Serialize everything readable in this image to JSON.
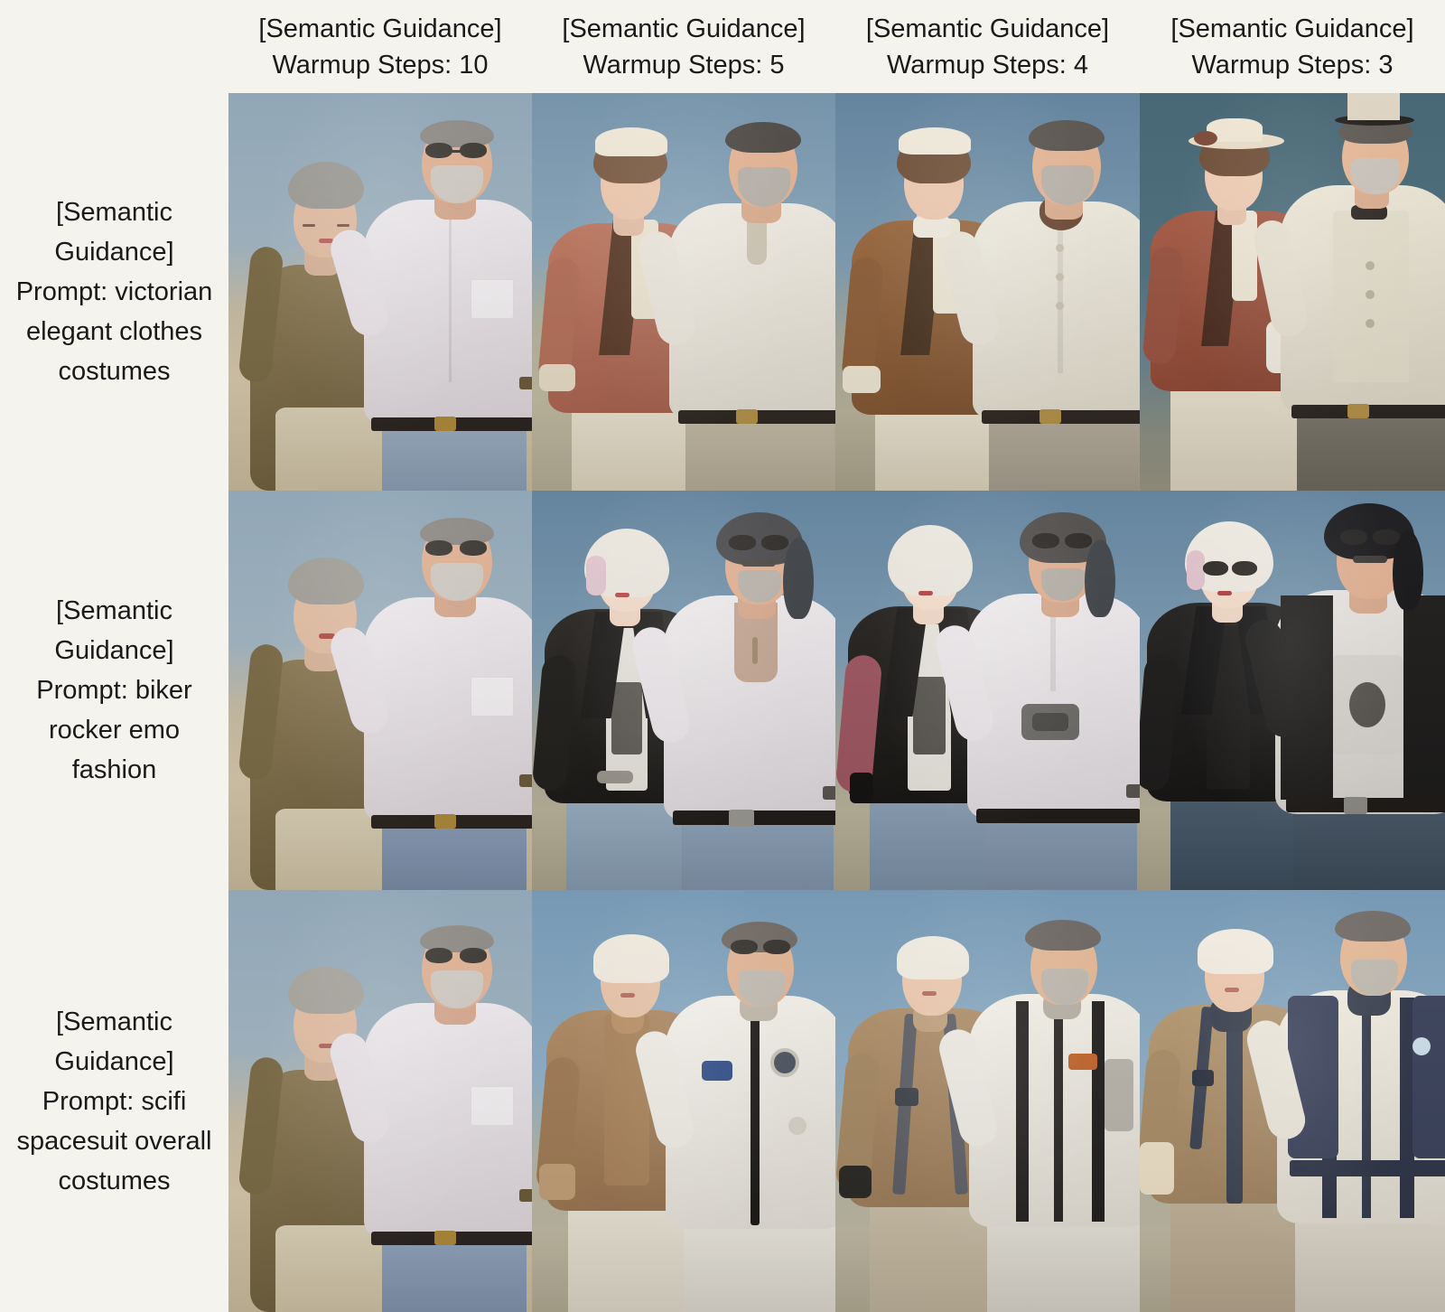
{
  "figure": {
    "background_color": "#f4f3ee",
    "text_color": "#1a1a1a",
    "grid": {
      "columns": 4,
      "rows": 3
    }
  },
  "columns": [
    {
      "line1": "[Semantic Guidance]",
      "line2": "Warmup Steps: 10",
      "warmup_steps": 10
    },
    {
      "line1": "[Semantic Guidance]",
      "line2": "Warmup Steps: 5",
      "warmup_steps": 5
    },
    {
      "line1": "[Semantic Guidance]",
      "line2": "Warmup Steps: 4",
      "warmup_steps": 4
    },
    {
      "line1": "[Semantic Guidance]",
      "line2": "Warmup Steps: 3",
      "warmup_steps": 3
    }
  ],
  "rows": [
    {
      "line1": "[Semantic",
      "line2": "Guidance]",
      "line3": "Prompt: victorian",
      "line4": "elegant clothes",
      "line5": "costumes",
      "prompt": "victorian elegant clothes costumes"
    },
    {
      "line1": "[Semantic",
      "line2": "Guidance]",
      "line3": "Prompt: biker",
      "line4": "rocker emo",
      "line5": "fashion",
      "prompt": "biker rocker emo fashion"
    },
    {
      "line1": "[Semantic",
      "line2": "Guidance]",
      "line3": "Prompt: scifi",
      "line4": "spacesuit overall",
      "line5": "costumes",
      "prompt": "scifi spacesuit overall costumes"
    }
  ],
  "cells": [
    {
      "id": "r1c1",
      "row_prompt": "victorian elegant clothes costumes",
      "warmup_steps": 10,
      "description": "Couple portrait outdoors: older woman with grey updo in brown lace cardigan and cream trousers, bearded man in sunglasses and white short-sleeve shirt with chest pocket, black belt, light blue trousers. Desert background, hazy blue sky.",
      "edit_strength": "none"
    },
    {
      "id": "r1c2",
      "row_prompt": "victorian elegant clothes costumes",
      "warmup_steps": 5,
      "description": "Woman in a rust/terracotta Victorian jacket with lace frills and white bonnet, man with grey beard in cream henley shirt and black belt. Blue sky background.",
      "edit_strength": "moderate"
    },
    {
      "id": "r1c3",
      "row_prompt": "victorian elegant clothes costumes",
      "warmup_steps": 4,
      "description": "Woman in brown Victorian jacket with high lace collar and white bonnet, man in cream waistcoat with brown cravat. Blue sky background.",
      "edit_strength": "strong"
    },
    {
      "id": "r1c4",
      "row_prompt": "victorian elegant clothes costumes",
      "warmup_steps": 3,
      "description": "Woman in deep rust bustle gown with lace sleeves, white gloves and wide brimmed hat; man in cream frock coat, waistcoat, bow tie and grey top hat. Dark teal background.",
      "edit_strength": "strongest"
    },
    {
      "id": "r2c1",
      "row_prompt": "biker rocker emo fashion",
      "warmup_steps": 10,
      "description": "Unchanged couple portrait: grey-haired woman in brown knit cardigan, bearded man in sunglasses and white shirt with black belt and blue jeans.",
      "edit_strength": "none"
    },
    {
      "id": "r2c2",
      "row_prompt": "biker rocker emo fashion",
      "warmup_steps": 5,
      "description": "Young woman with platinum-blonde pink-tipped bob in black leather biker jacket over graphic tee and jeans; long-haired man with sunglasses and moustache in open white shirt, black belt, jeans.",
      "edit_strength": "moderate"
    },
    {
      "id": "r2c3",
      "row_prompt": "biker rocker emo fashion",
      "warmup_steps": 4,
      "description": "Platinum blonde woman in black leather vest with maroon sleeves over graphic tee, man with sunglasses in white shirt with large metal belt buckle and jeans.",
      "edit_strength": "strong"
    },
    {
      "id": "r2c4",
      "row_prompt": "biker rocker emo fashion",
      "warmup_steps": 3,
      "description": "Blonde woman with dark sunglasses in black leather jacket and black tank; spiky black-haired man in sunglasses, leather vest over skull graphic white tee, studded belt and dark jeans.",
      "edit_strength": "strongest"
    },
    {
      "id": "r3c1",
      "row_prompt": "scifi spacesuit overall costumes",
      "warmup_steps": 10,
      "description": "Unchanged couple portrait: grey-haired woman in brown cardigan, bearded man in sunglasses and white shirt with black belt, desert backdrop.",
      "edit_strength": "none"
    },
    {
      "id": "r3c2",
      "row_prompt": "scifi spacesuit overall costumes",
      "warmup_steps": 5,
      "description": "Woman in tan high-neck flight suit with white head wrap; man in white spacesuit with black zip, circular port and mission patch. Blue sky.",
      "edit_strength": "moderate"
    },
    {
      "id": "r3c3",
      "row_prompt": "scifi spacesuit overall costumes",
      "warmup_steps": 4,
      "description": "Woman in sleeveless tan jumpsuit with harness straps and white cap; man in white spacesuit with black harness, orange patch and grey panels.",
      "edit_strength": "strong"
    },
    {
      "id": "r3c4",
      "row_prompt": "scifi spacesuit overall costumes",
      "warmup_steps": 3,
      "description": "Woman in tan catsuit with navy ribbed collar and harness plus white helmet cap; man in cream spacesuit with navy ribbed collar, navy harness straps and shoulder panels.",
      "edit_strength": "strongest"
    }
  ]
}
